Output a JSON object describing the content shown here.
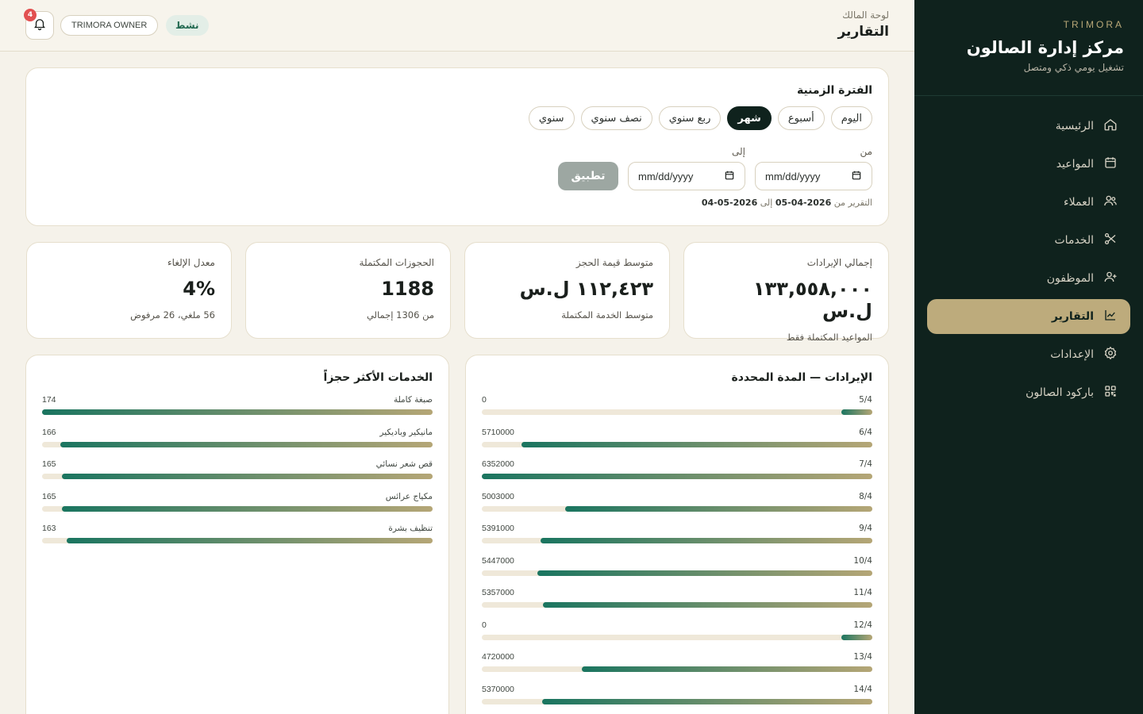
{
  "sidebar": {
    "brand_tag": "TRIMORA",
    "title": "مركز إدارة الصالون",
    "subtitle": "تشغيل يومي ذكي ومتصل",
    "items": [
      {
        "label": "الرئيسية",
        "icon": "home-icon"
      },
      {
        "label": "المواعيد",
        "icon": "calendar-icon"
      },
      {
        "label": "العملاء",
        "icon": "users-icon"
      },
      {
        "label": "الخدمات",
        "icon": "scissors-icon"
      },
      {
        "label": "الموظفون",
        "icon": "user-plus-icon"
      },
      {
        "label": "التقارير",
        "icon": "chart-icon",
        "active": true
      },
      {
        "label": "الإعدادات",
        "icon": "gear-icon"
      },
      {
        "label": "باركود الصالون",
        "icon": "qr-icon"
      }
    ]
  },
  "header": {
    "crumb": "لوحة المالك",
    "title": "التقارير",
    "status": "نشط",
    "owner": "TRIMORA OWNER",
    "notifications": "4"
  },
  "period": {
    "title": "الفترة الزمنية",
    "chips": [
      "اليوم",
      "أسبوع",
      "شهر",
      "ربع سنوي",
      "نصف سنوي",
      "سنوي"
    ],
    "selected": "شهر",
    "from_label": "من",
    "to_label": "إلى",
    "date_placeholder": "mm/dd/yyyy",
    "apply": "تطبيق",
    "note_prefix": "التقرير من",
    "note_from": "2026-04-05",
    "note_mid": "إلى",
    "note_to": "2026-05-04"
  },
  "kpis": [
    {
      "label": "إجمالي الإيرادات",
      "value": "١٣٣,٥٥٨,٠٠٠ ل.س",
      "sub": "المواعيد المكتملة فقط"
    },
    {
      "label": "متوسط قيمة الحجز",
      "value": "١١٢,٤٢٣ ل.س",
      "sub": "متوسط الخدمة المكتملة"
    },
    {
      "label": "الحجوزات المكتملة",
      "value": "1188",
      "sub": "من 1306 إجمالي"
    },
    {
      "label": "معدل الإلغاء",
      "value": "4%",
      "sub": "56 ملغي، 26 مرفوض"
    }
  ],
  "revenue_chart": {
    "title": "الإيرادات — المدة المحددة",
    "max": 6352000,
    "rows": [
      {
        "label": "5/4",
        "value": 0
      },
      {
        "label": "6/4",
        "value": 5710000
      },
      {
        "label": "7/4",
        "value": 6352000
      },
      {
        "label": "8/4",
        "value": 5003000
      },
      {
        "label": "9/4",
        "value": 5391000
      },
      {
        "label": "10/4",
        "value": 5447000
      },
      {
        "label": "11/4",
        "value": 5357000
      },
      {
        "label": "12/4",
        "value": 0
      },
      {
        "label": "13/4",
        "value": 4720000
      },
      {
        "label": "14/4",
        "value": 5370000
      }
    ]
  },
  "services_chart": {
    "title": "الخدمات الأكثر حجزاً",
    "max": 174,
    "rows": [
      {
        "label": "صبغة كاملة",
        "value": 174
      },
      {
        "label": "مانيكير وباديكير",
        "value": 166
      },
      {
        "label": "قص شعر نسائي",
        "value": 165
      },
      {
        "label": "مكياج عرائس",
        "value": 165
      },
      {
        "label": "تنظيف بشرة",
        "value": 163
      }
    ]
  },
  "chart_data": [
    {
      "type": "bar",
      "title": "الإيرادات — المدة المحددة",
      "categories": [
        "5/4",
        "6/4",
        "7/4",
        "8/4",
        "9/4",
        "10/4",
        "11/4",
        "12/4",
        "13/4",
        "14/4"
      ],
      "values": [
        0,
        5710000,
        6352000,
        5003000,
        5391000,
        5447000,
        5357000,
        0,
        4720000,
        5370000
      ]
    },
    {
      "type": "bar",
      "title": "الخدمات الأكثر حجزاً",
      "categories": [
        "صبغة كاملة",
        "مانيكير وباديكير",
        "قص شعر نسائي",
        "مكياج عرائس",
        "تنظيف بشرة"
      ],
      "values": [
        174,
        166,
        165,
        165,
        163
      ]
    }
  ]
}
